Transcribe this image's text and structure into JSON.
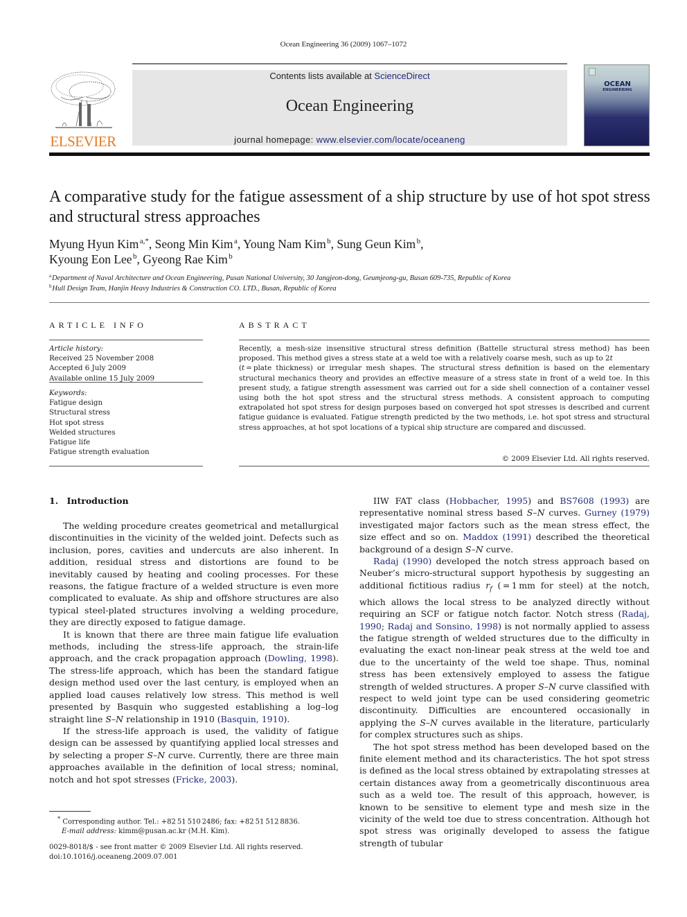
{
  "running_head": "Ocean Engineering 36 (2009) 1067–1072",
  "masthead": {
    "publisher_logo_text": "ELSEVIER",
    "contents_prefix": "Contents lists available at ",
    "contents_link": "ScienceDirect",
    "journal_name": "Ocean Engineering",
    "homepage_prefix": "journal homepage: ",
    "homepage_link": "www.elsevier.com/locate/oceaneng",
    "cover_title": "OCEAN",
    "cover_subtitle": "ENGINEERING",
    "brand_color": "#e37b26",
    "link_color": "#1f2a7c"
  },
  "article": {
    "title": "A comparative study for the fatigue assessment of a ship structure by use of hot spot stress and structural stress approaches",
    "authors": [
      {
        "name": "Myung Hyun Kim",
        "sup": "a,*",
        "sep": ", "
      },
      {
        "name": "Seong Min Kim",
        "sup": "a",
        "sep": ", "
      },
      {
        "name": "Young Nam Kim",
        "sup": "b",
        "sep": ", "
      },
      {
        "name": "Sung Geun Kim",
        "sup": "b",
        "sep": ","
      },
      {
        "name": "Kyoung Eon Lee",
        "sup": "b",
        "sep": ", "
      },
      {
        "name": "Gyeong Rae Kim",
        "sup": "b",
        "sep": ""
      }
    ],
    "affiliations": [
      {
        "key": "a",
        "text": "Department of Naval Architecture and Ocean Engineering, Pusan National University, 30 Jangjeon-dong, Geumjeong-gu, Busan 609-735, Republic of Korea"
      },
      {
        "key": "b",
        "text": "Hull Design Team, Hanjin Heavy Industries & Construction CO. LTD., Busan, Republic of Korea"
      }
    ]
  },
  "article_info": {
    "heading": "ARTICLE INFO",
    "history_label": "Article history:",
    "history": [
      "Received 25 November 2008",
      "Accepted 6 July 2009",
      "Available online 15 July 2009"
    ],
    "keywords_label": "Keywords:",
    "keywords": [
      "Fatigue design",
      "Structural stress",
      "Hot spot stress",
      "Welded structures",
      "Fatigue life",
      "Fatigue strength evaluation"
    ]
  },
  "abstract": {
    "heading": "ABSTRACT",
    "p1": "Recently, a mesh-size insensitive structural stress definition (Battelle structural stress method) has been proposed. This method gives a stress state at a weld toe with a relatively coarse mesh, such as up to 2",
    "p1_t": "t",
    "p2_open": " (",
    "p2_t": "t",
    "p2": " = plate thickness) or irregular mesh shapes. The structural stress definition is based on the elementary structural mechanics theory and provides an effective measure of a stress state in front of a weld toe. In this present study, a fatigue strength assessment was carried out for a side shell connection of a container vessel using both the hot spot stress and the structural stress methods. A consistent approach to computing extrapolated hot spot stress for design purposes based on converged hot spot stresses is described and current fatigue guidance is evaluated. Fatigue strength predicted by the two methods, i.e. hot spot stress and structural stress approaches, at hot spot locations of a typical ship structure are compared and discussed.",
    "copyright": "© 2009 Elsevier Ltd. All rights reserved."
  },
  "intro": {
    "heading": "1. Introduction",
    "left": {
      "p1": "The welding procedure creates geometrical and metallurgical discontinuities in the vicinity of the welded joint. Defects such as inclusion, pores, cavities and undercuts are also inherent. In addition, residual stress and distortions are found to be inevitably caused by heating and cooling processes. For these reasons, the fatigue fracture of a welded structure is even more complicated to evaluate. As ship and offshore structures are also typical steel-plated structures involving a welding procedure, they are directly exposed to fatigue damage.",
      "p2a": "It is known that there are three main fatigue life evaluation methods, including the stress-life approach, the strain-life approach, and the crack propagation approach (",
      "p2_ref1": "Dowling, 1998",
      "p2b": "). The stress-life approach, which has been the standard fatigue design method used over the last century, is employed when an applied load causes relatively low stress. This method is well presented by Basquin who suggested establishing a log–log straight line ",
      "sn": "S–N",
      "p2c": " relationship in 1910 (",
      "p2_ref2": "Basquin, 1910",
      "p2d": ").",
      "p3a": "If the stress-life approach is used, the validity of fatigue design can be assessed by quantifying applied local stresses and by selecting a proper ",
      "p3b": " curve. Currently, there are three main approaches available in the definition of local stress; nominal, notch and hot spot stresses (",
      "p3_ref": "Fricke, 2003",
      "p3c": ")."
    },
    "right": {
      "p1a": "IIW FAT class (",
      "ref_hob": "Hobbacher, 1995",
      "p1b": ") and ",
      "ref_bs": "BS7608 (1993)",
      "p1c": " are representative nominal stress based ",
      "p1d": " curves. ",
      "ref_gurney": "Gurney (1979)",
      "p1e": " investigated major factors such as the mean stress effect, the size effect and so on. ",
      "ref_maddox": "Maddox (1991)",
      "p1f": " described the theoretical background of a design ",
      "p1g": " curve.",
      "ref_radaj": "Radaj (1990)",
      "p2a": " developed the notch stress approach based on Neuber’s micro-structural support hypothesis by suggesting an additional fictitious radius ",
      "rf": "r",
      "rf_sub": "f",
      "p2b": " ( = 1 mm for steel) at the notch, which allows the local stress to be analyzed directly without requiring an SCF or fatigue notch factor. Notch stress (",
      "ref_radaj2": "Radaj, 1990",
      "p2c": "; ",
      "ref_rs": "Radaj and Sonsino, 1998",
      "p2d": ") is not normally applied to assess the fatigue strength of welded structures due to the difficulty in evaluating the exact non-linear peak stress at the weld toe and due to the uncertainty of the weld toe shape. Thus, nominal stress has been extensively employed to assess the fatigue strength of welded structures. A proper ",
      "p2e": " curve classified with respect to weld joint type can be used considering geometric discontinuity. Difficulties are encountered occasionally in applying the ",
      "p2f": " curves available in the literature, particularly for complex structures such as ships.",
      "p3": "The hot spot stress method has been developed based on the finite element method and its characteristics. The hot spot stress is defined as the local stress obtained by extrapolating stresses at certain distances away from a geometrically discontinuous area such as a weld toe. The result of this approach, however, is known to be sensitive to element type and mesh size in the vicinity of the weld toe due to stress concentration. Although hot spot stress was originally developed to assess the fatigue strength of tubular"
    }
  },
  "footnote": {
    "marker": "*",
    "corresponding": " Corresponding author. Tel.: +82 51 510 2486; fax: +82 51 512 8836.",
    "email_label": "E-mail address:",
    "email": " kimm@pusan.ac.kr (M.H. Kim)."
  },
  "front_matter": {
    "issn_line": "0029-8018/$ - see front matter © 2009 Elsevier Ltd. All rights reserved.",
    "doi": "doi:10.1016/j.oceaneng.2009.07.001"
  }
}
